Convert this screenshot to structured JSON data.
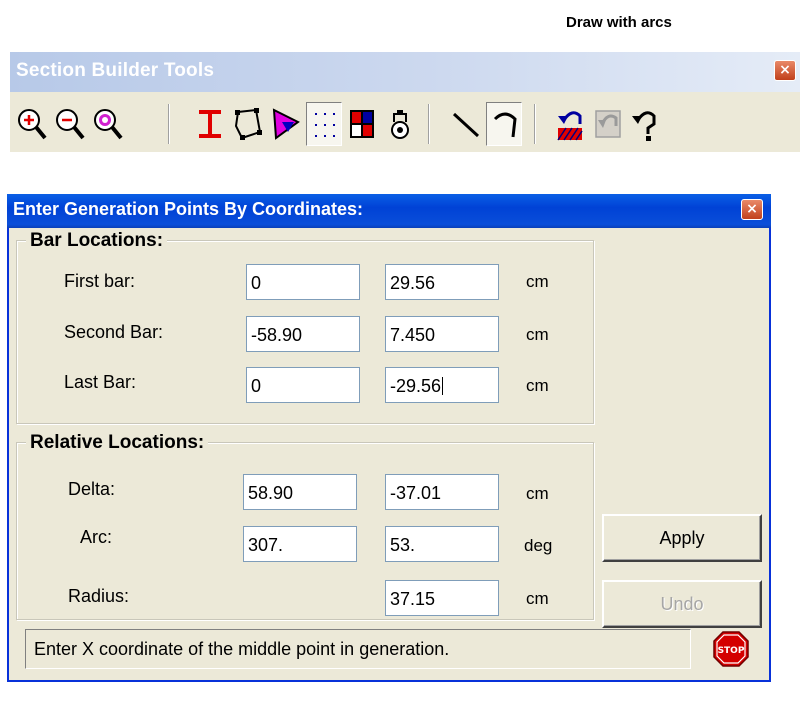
{
  "caption": "Draw with arcs",
  "toolbar": {
    "title": "Section Builder Tools",
    "close": "×",
    "buttons": [
      {
        "name": "zoom-in-icon"
      },
      {
        "name": "zoom-out-icon"
      },
      {
        "name": "zoom-extents-icon"
      },
      {
        "name": "i-beam-icon"
      },
      {
        "name": "polygon-icon"
      },
      {
        "name": "fill-polygon-icon"
      },
      {
        "name": "point-grid-icon",
        "active": true
      },
      {
        "name": "grid-cells-icon"
      },
      {
        "name": "clamp-icon"
      },
      {
        "name": "draw-line-icon"
      },
      {
        "name": "draw-arc-icon",
        "active": true
      },
      {
        "name": "undo-section-icon"
      },
      {
        "name": "undo-disabled-icon",
        "disabled": true
      },
      {
        "name": "redo-icon"
      }
    ]
  },
  "dialog": {
    "title": "Enter Generation Points By Coordinates:",
    "close": "×",
    "bar_locations": {
      "label": "Bar Locations:",
      "rows": [
        {
          "label": "First bar:",
          "x": "0",
          "y": "29.56",
          "unit": "cm"
        },
        {
          "label": "Second Bar:",
          "x": "-58.90",
          "y": "7.450",
          "unit": "cm"
        },
        {
          "label": "Last Bar:",
          "x": "0",
          "y": "-29.56",
          "unit": "cm"
        }
      ]
    },
    "relative_locations": {
      "label": "Relative Locations:",
      "delta": {
        "label": "Delta:",
        "x": "58.90",
        "y": "-37.01",
        "unit": "cm"
      },
      "arc": {
        "label": "Arc:",
        "x": "307.",
        "y": "53.",
        "unit": "deg"
      },
      "radius": {
        "label": "Radius:",
        "value": "37.15",
        "unit": "cm"
      }
    },
    "apply_label": "Apply",
    "undo_label": "Undo",
    "status": "Enter X coordinate of the middle point in generation.",
    "stop_label": "STOP"
  }
}
